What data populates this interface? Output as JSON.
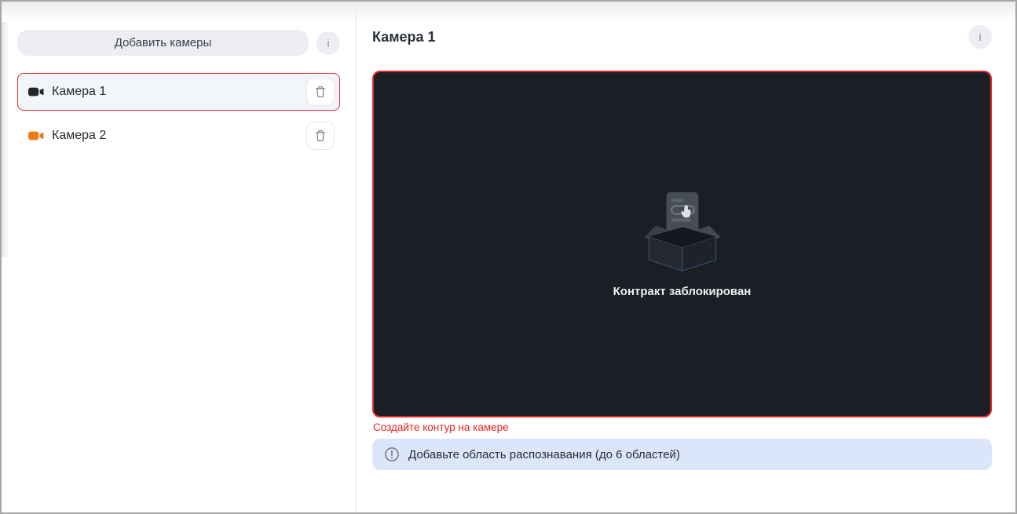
{
  "sidebar": {
    "add_button_label": "Добавить камеры",
    "info_button_glyph": "i",
    "cameras": [
      {
        "name": "Камера 1",
        "selected": true
      },
      {
        "name": "Камера 2",
        "selected": false
      }
    ]
  },
  "main": {
    "title": "Камера 1",
    "info_button_glyph": "i",
    "video_placeholder_text": "Контракт заблокирован",
    "validation_message": "Создайте контур на камере",
    "hint_banner_text": "Добавьте область распознавания (до 6 областей)"
  },
  "icons": {
    "camera_selected": "video-camera-icon (dark)",
    "camera_unselected": "video-camera-icon (orange)",
    "delete": "trash-icon",
    "info": "i-circle-icon",
    "hint": "exclamation-circle-icon",
    "illustration": "empty-open-box-with-form-and-cursor"
  },
  "colors": {
    "selected_border": "#e0312d",
    "video_border": "#df2b2b",
    "video_background": "#1b1e24",
    "error_text": "#e42320",
    "banner_background": "#dce6fa",
    "button_background": "#eceef3",
    "camera1_icon": "#23272e",
    "camera2_icon": "#ee7a16"
  }
}
